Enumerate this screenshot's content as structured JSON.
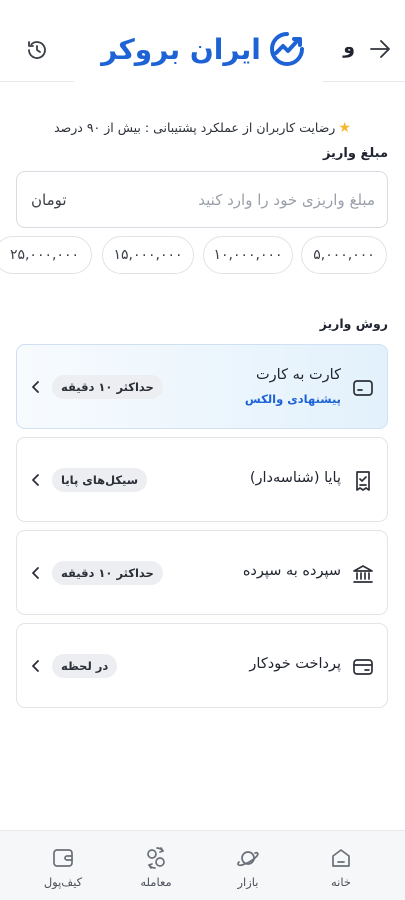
{
  "header": {
    "logo_text": "ایران بروکر",
    "partial_letter": "و"
  },
  "satisfaction": "رضایت کاربران از عملکرد پشتیبانی : بیش از ۹۰ درصد",
  "amount": {
    "title": "مبلغ واریز",
    "placeholder": "مبلغ واریزی خود را وارد کنید",
    "unit": "تومان"
  },
  "presets": [
    "۵,۰۰۰,۰۰۰",
    "۱۰,۰۰۰,۰۰۰",
    "۱۵,۰۰۰,۰۰۰",
    "۲۵,۰۰۰,۰۰۰"
  ],
  "methods_title": "روش واریز",
  "methods": [
    {
      "title": "کارت به کارت",
      "subtitle": "پیشنهادی والکس",
      "badge": "حداکثر ۱۰ دقیقه",
      "icon": "card-icon"
    },
    {
      "title": "پایا (شناسه‌دار)",
      "subtitle": "",
      "badge": "سیکل‌های پایا",
      "icon": "receipt-icon"
    },
    {
      "title": "سپرده به سپرده",
      "subtitle": "",
      "badge": "حداکثر ۱۰ دقیقه",
      "icon": "bank-icon"
    },
    {
      "title": "پرداخت خودکار",
      "subtitle": "",
      "badge": "در لحظه",
      "icon": "auto-card-icon"
    }
  ],
  "nav": [
    {
      "label": "خانه",
      "icon": "home-icon"
    },
    {
      "label": "بازار",
      "icon": "planet-icon"
    },
    {
      "label": "معامله",
      "icon": "trade-icon"
    },
    {
      "label": "کیف‌پول",
      "icon": "wallet-icon"
    }
  ],
  "colors": {
    "accent": "#1e63d6",
    "star": "#f5b82e",
    "active_bg": "#e3f1fc"
  }
}
